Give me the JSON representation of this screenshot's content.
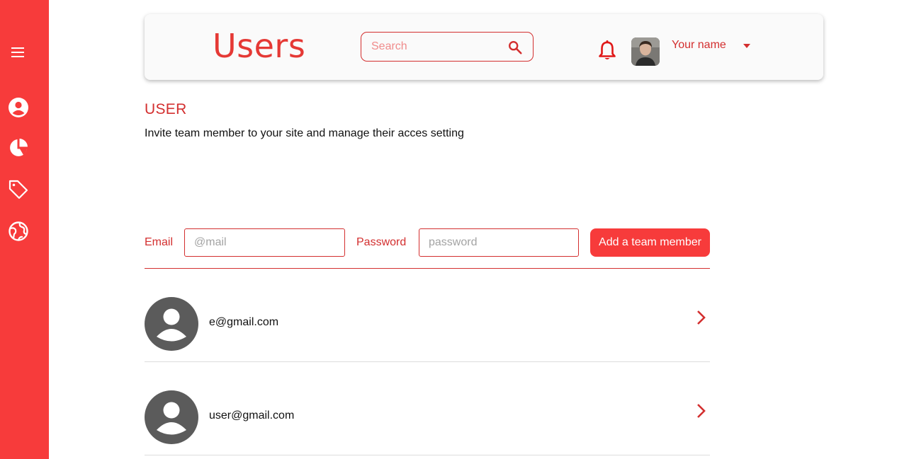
{
  "sidebar": {
    "items": [
      {
        "icon": "menu-icon"
      },
      {
        "icon": "account-circle-icon"
      },
      {
        "icon": "pie-chart-icon"
      },
      {
        "icon": "tag-icon"
      },
      {
        "icon": "globe-icon"
      }
    ]
  },
  "header": {
    "title": "Users",
    "search": {
      "placeholder": "Search",
      "icon": "search-icon"
    },
    "notification_icon": "bell-icon",
    "user_name": "Your name",
    "dropdown_icon": "caret-down-icon"
  },
  "section": {
    "title": "USER",
    "description": "Invite team member to your site and manage their acces setting"
  },
  "form": {
    "email_label": "Email",
    "email_placeholder": "@mail",
    "password_label": "Password",
    "password_placeholder": "password",
    "submit_label": "Add a team member"
  },
  "users": [
    {
      "email": "e@gmail.com"
    },
    {
      "email": "user@gmail.com"
    }
  ],
  "colors": {
    "accent": "#f73b3b",
    "accent_dark": "#d32f2f",
    "avatar_gray": "#5b5b5b"
  }
}
